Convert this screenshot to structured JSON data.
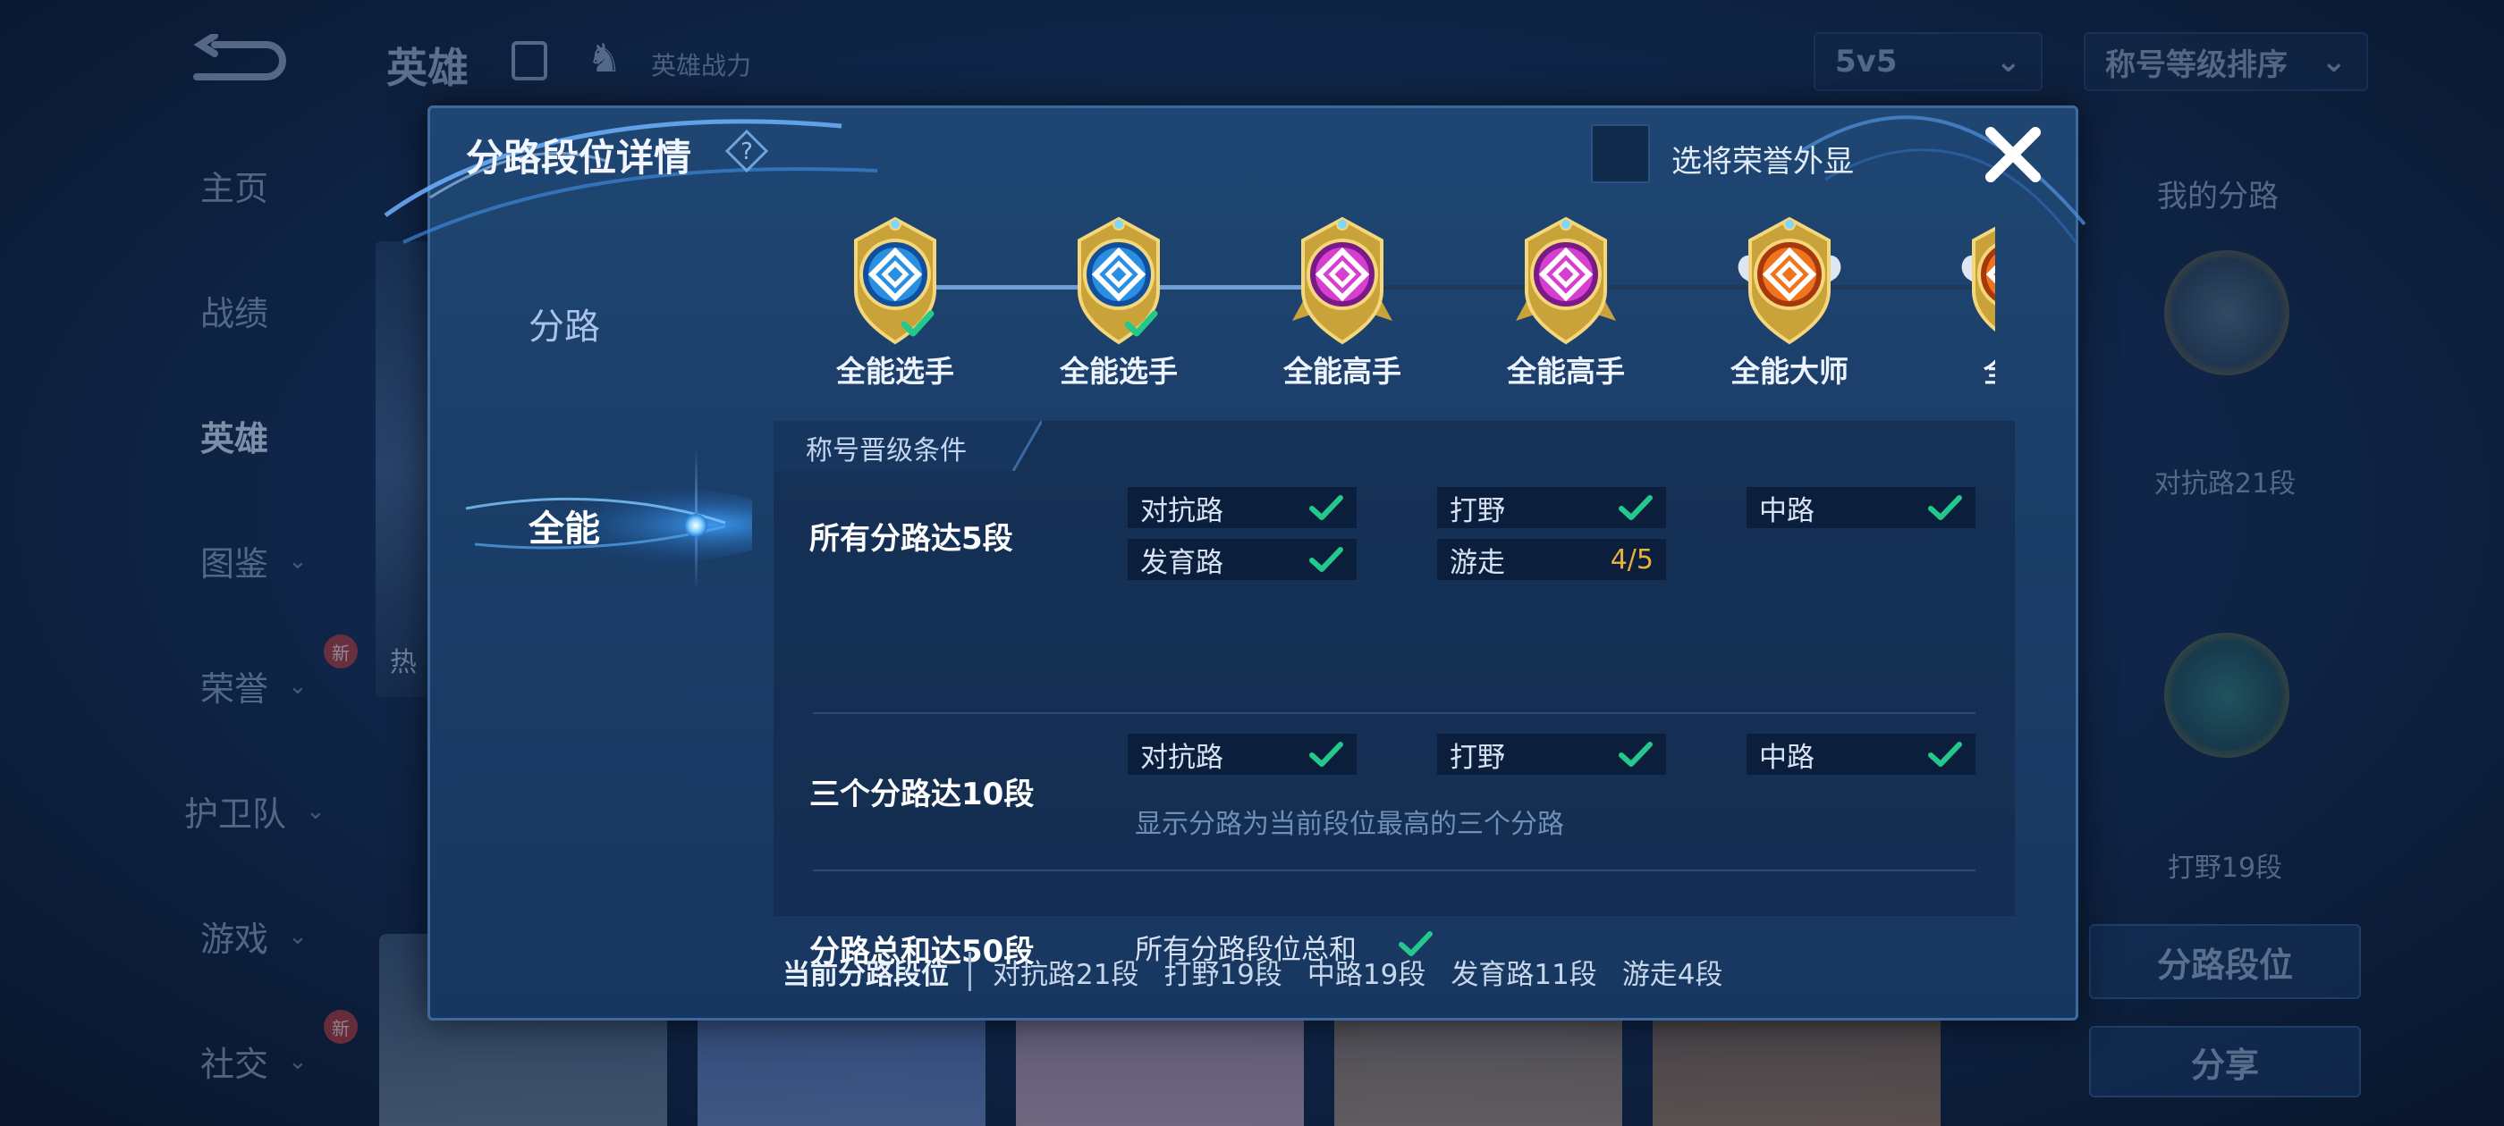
{
  "background": {
    "top_title": "英雄",
    "power_label": "英雄战力",
    "mode_select": "5v5",
    "sort_select": "称号等级排序",
    "nav": [
      {
        "label": "主页",
        "chev": false,
        "badge": ""
      },
      {
        "label": "战绩",
        "chev": false,
        "badge": ""
      },
      {
        "label": "英雄",
        "chev": false,
        "badge": "",
        "active": true
      },
      {
        "label": "图鉴",
        "chev": true,
        "badge": ""
      },
      {
        "label": "荣誉",
        "chev": true,
        "badge": "新"
      },
      {
        "label": "护卫队",
        "chev": true,
        "badge": ""
      },
      {
        "label": "游戏",
        "chev": true,
        "badge": ""
      },
      {
        "label": "社交",
        "chev": true,
        "badge": "新"
      }
    ],
    "left_card_text": "热",
    "right_panel": {
      "title": "我的分路",
      "label1": "对抗路21段",
      "label2": "打野19段",
      "button1": "分路段位",
      "button2": "分享"
    }
  },
  "modal": {
    "title": "分路段位详情",
    "honor_label": "选将荣誉外显",
    "tabs": [
      {
        "label": "分路",
        "active": false
      },
      {
        "label": "全能",
        "active": true
      }
    ],
    "ranks": [
      {
        "label": "全能选手",
        "tier": "blue",
        "achieved": true
      },
      {
        "label": "全能选手",
        "tier": "blue",
        "achieved": true
      },
      {
        "label": "全能高手",
        "tier": "purple",
        "achieved": false
      },
      {
        "label": "全能高手",
        "tier": "purple",
        "achieved": false
      },
      {
        "label": "全能大师",
        "tier": "orange",
        "achieved": false
      },
      {
        "label": "全能",
        "tier": "orange",
        "achieved": false
      }
    ],
    "conditions_header": "称号晋级条件",
    "conditions": {
      "row1": {
        "title": "所有分路达5段",
        "chips": [
          {
            "label": "对抗路",
            "done": true,
            "value": ""
          },
          {
            "label": "打野",
            "done": true,
            "value": ""
          },
          {
            "label": "中路",
            "done": true,
            "value": ""
          },
          {
            "label": "发育路",
            "done": true,
            "value": ""
          },
          {
            "label": "游走",
            "done": false,
            "value": "4/5"
          }
        ]
      },
      "row2": {
        "title": "三个分路达10段",
        "chips": [
          {
            "label": "对抗路",
            "done": true
          },
          {
            "label": "打野",
            "done": true
          },
          {
            "label": "中路",
            "done": true
          }
        ],
        "note": "显示分路为当前段位最高的三个分路"
      },
      "row3": {
        "title": "分路总和达50段",
        "text": "所有分路段位总和",
        "done": true
      }
    },
    "footer": {
      "label": "当前分路段位",
      "items": [
        "对抗路21段",
        "打野19段",
        "中路19段",
        "发育路11段",
        "游走4段"
      ]
    }
  },
  "colors": {
    "check": "#23c88a",
    "progress_value": "#e7b13a",
    "modal_bg": "#1c416c",
    "accent_blue": "#4f8cd0"
  }
}
